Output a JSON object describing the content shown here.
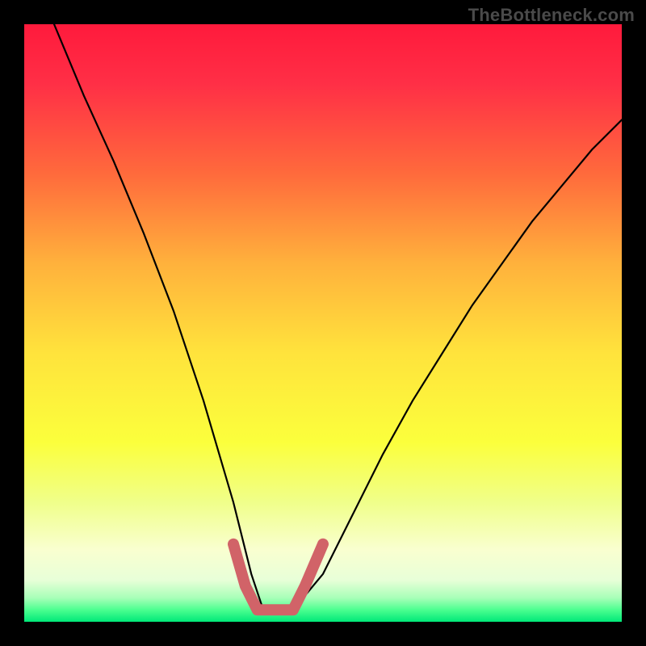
{
  "watermark": "TheBottleneck.com",
  "chart_data": {
    "type": "line",
    "title": "",
    "xlabel": "",
    "ylabel": "",
    "xlim": [
      0,
      100
    ],
    "ylim": [
      0,
      100
    ],
    "grid": false,
    "legend": false,
    "series": [
      {
        "name": "bottleneck-curve",
        "color": "#000000",
        "x": [
          5,
          10,
          15,
          20,
          25,
          30,
          35,
          38,
          40,
          42,
          45,
          50,
          55,
          60,
          65,
          70,
          75,
          80,
          85,
          90,
          95,
          100
        ],
        "y": [
          100,
          88,
          77,
          65,
          52,
          37,
          20,
          8,
          2,
          2,
          2,
          8,
          18,
          28,
          37,
          45,
          53,
          60,
          67,
          73,
          79,
          84
        ]
      },
      {
        "name": "flat-bottom-highlight",
        "color": "#d16368",
        "x": [
          35,
          37,
          39,
          41,
          43,
          45,
          47,
          50
        ],
        "y": [
          13,
          6,
          2,
          2,
          2,
          2,
          6,
          13
        ]
      }
    ],
    "background_gradient": {
      "stops": [
        {
          "pos": 0.0,
          "color": "#ff1a3c"
        },
        {
          "pos": 0.1,
          "color": "#ff2f46"
        },
        {
          "pos": 0.25,
          "color": "#ff6a3c"
        },
        {
          "pos": 0.4,
          "color": "#ffb13c"
        },
        {
          "pos": 0.55,
          "color": "#ffe33c"
        },
        {
          "pos": 0.7,
          "color": "#fbff3c"
        },
        {
          "pos": 0.8,
          "color": "#f0ff8a"
        },
        {
          "pos": 0.88,
          "color": "#f9ffd0"
        },
        {
          "pos": 0.93,
          "color": "#e8ffd8"
        },
        {
          "pos": 0.96,
          "color": "#a8ffb8"
        },
        {
          "pos": 0.98,
          "color": "#4cff90"
        },
        {
          "pos": 1.0,
          "color": "#00e878"
        }
      ]
    }
  }
}
